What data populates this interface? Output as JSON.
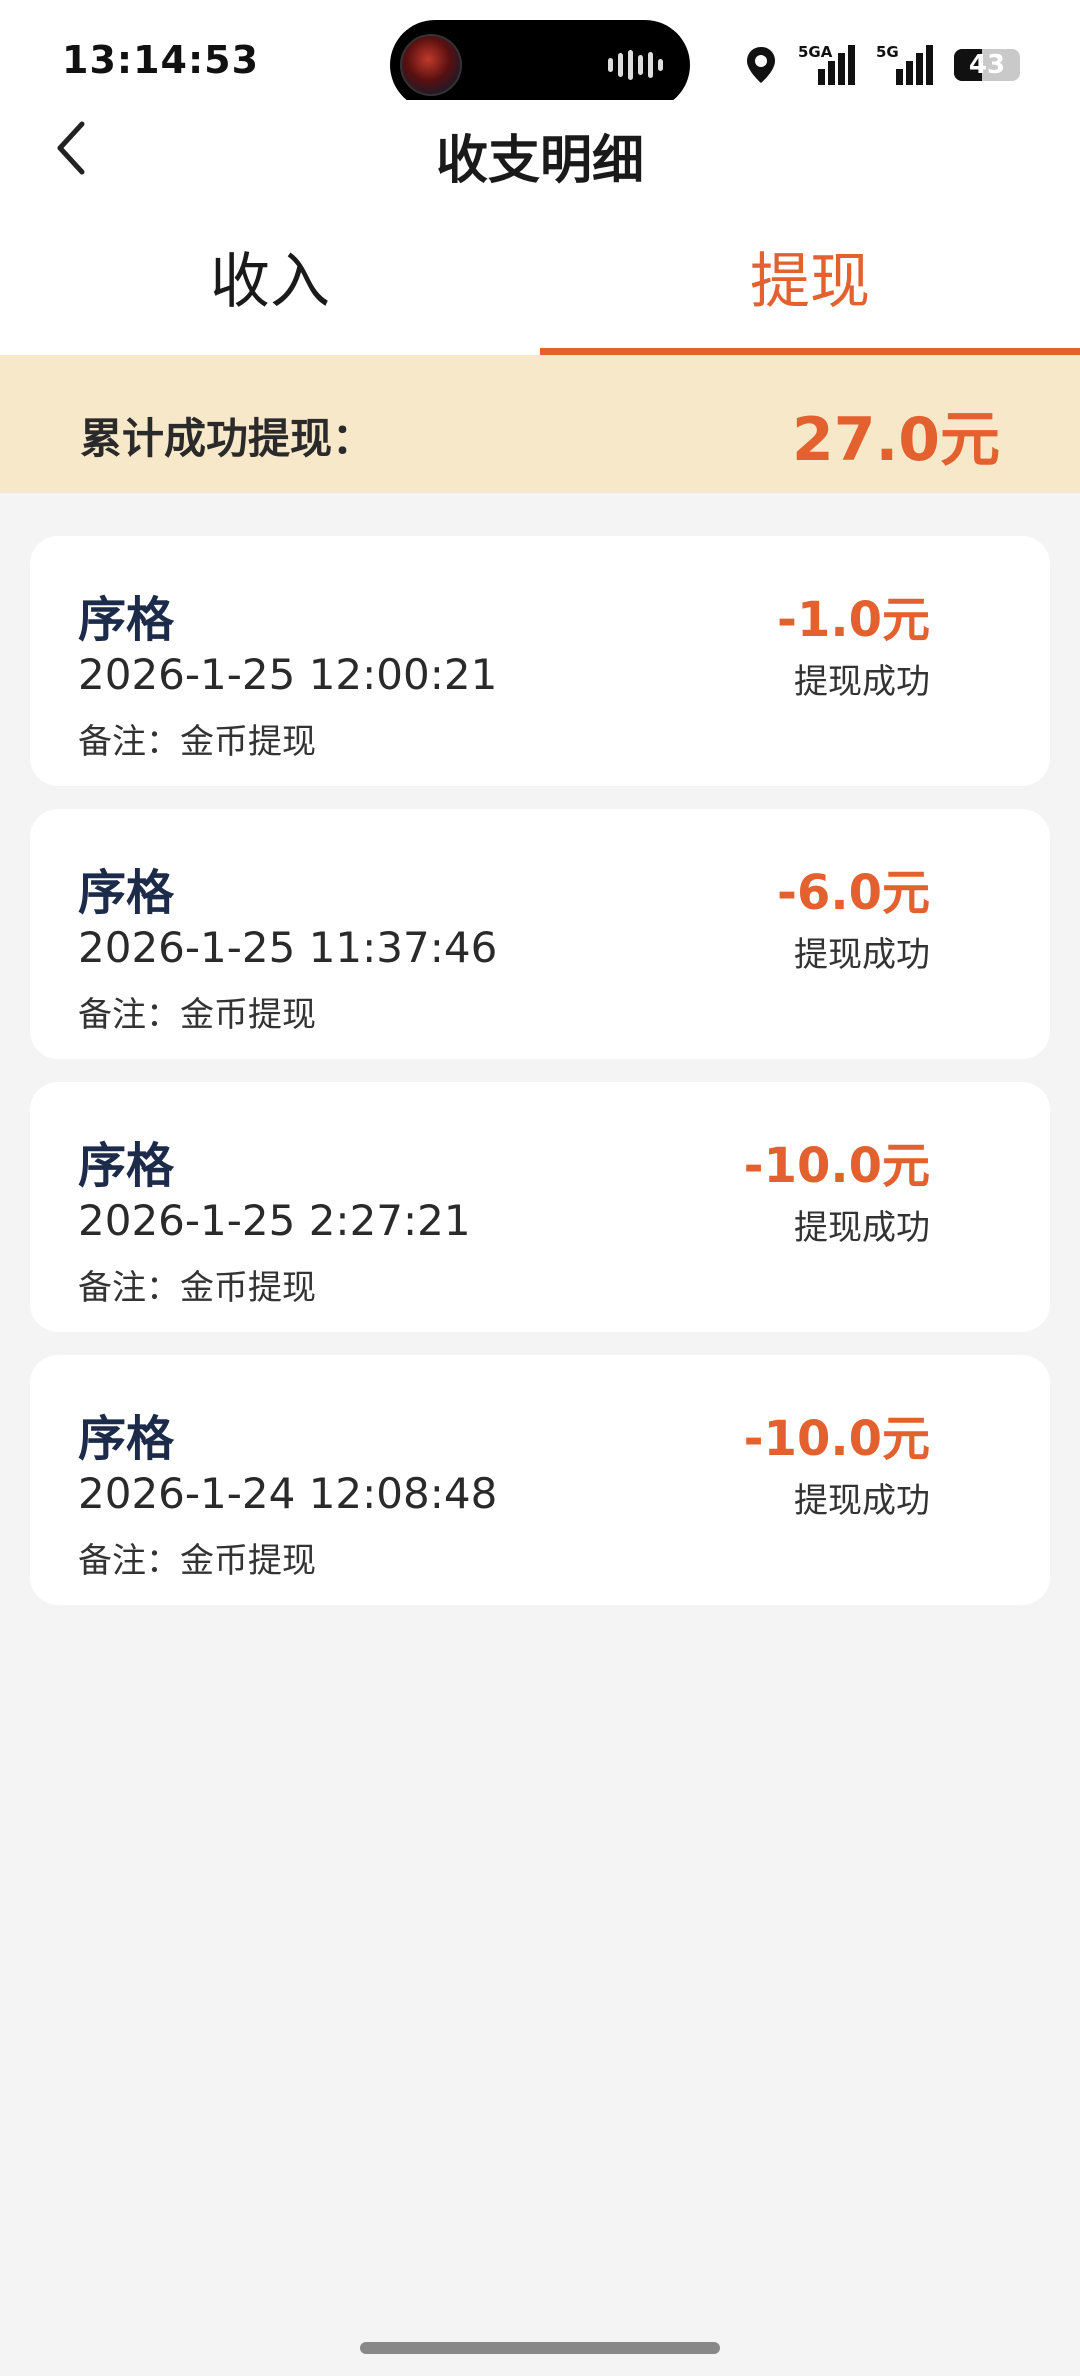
{
  "status_bar": {
    "time": "13:14:53",
    "network_1": "5GA",
    "network_2": "5G",
    "battery": "43",
    "icons": [
      "location-icon",
      "signal-icon",
      "signal-icon",
      "battery-icon"
    ]
  },
  "header": {
    "title": "收支明细",
    "back_icon": "chevron-left-icon"
  },
  "tabs": [
    {
      "label": "收入",
      "active": false
    },
    {
      "label": "提现",
      "active": true
    }
  ],
  "summary": {
    "label": "累计成功提现：",
    "value": "27.0元"
  },
  "records": [
    {
      "name": "序格",
      "time": "2026-1-25 12:00:21",
      "note": "备注：金币提现",
      "amount": "-1.0元",
      "status": "提现成功"
    },
    {
      "name": "序格",
      "time": "2026-1-25 11:37:46",
      "note": "备注：金币提现",
      "amount": "-6.0元",
      "status": "提现成功"
    },
    {
      "name": "序格",
      "time": "2026-1-25 2:27:21",
      "note": "备注：金币提现",
      "amount": "-10.0元",
      "status": "提现成功"
    },
    {
      "name": "序格",
      "time": "2026-1-24 12:08:48",
      "note": "备注：金币提现",
      "amount": "-10.0元",
      "status": "提现成功"
    }
  ],
  "colors": {
    "accent": "#e2612f",
    "summary_bg": "#f7e8c9",
    "name_text": "#1d2b4a",
    "page_bg": "#f4f4f4"
  }
}
